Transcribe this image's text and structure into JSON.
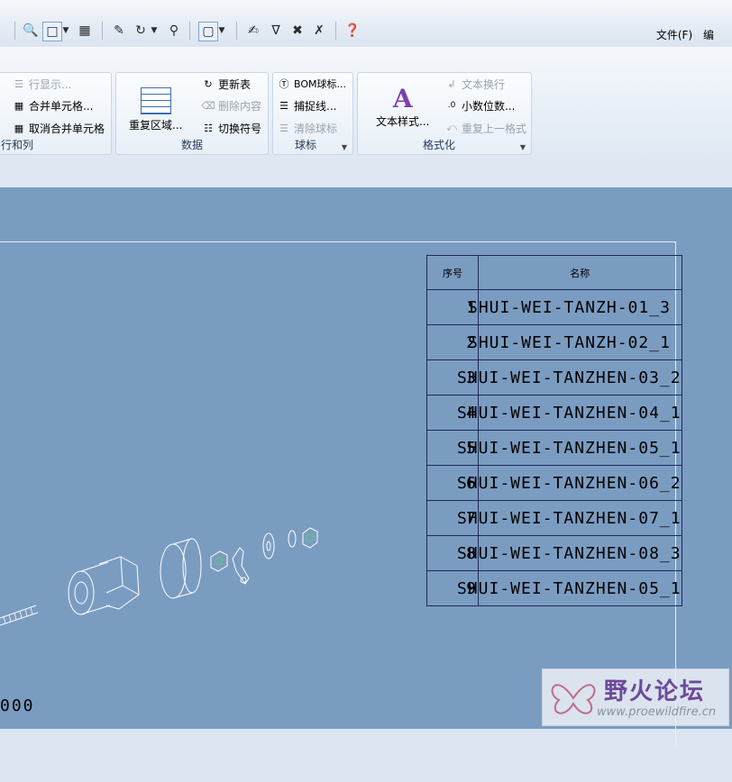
{
  "quick_access": {
    "icons": [
      "binoculars-icon",
      "select-box-icon",
      "dropdown-arrow-icon",
      "table-tool-icon",
      "edit-icon",
      "refresh-icon",
      "zoom-icon",
      "view-box-icon",
      "annotation-icon",
      "annotation-2-icon",
      "annotation-3-icon",
      "annotation-4-icon",
      "help-pointer-icon"
    ],
    "file_menu": "文件(F)",
    "cut_label": "编"
  },
  "ribbon": {
    "rows_cols": {
      "title": "行和列",
      "items": [
        {
          "label": "行显示...",
          "disabled": true
        },
        {
          "label": "合并单元格...",
          "disabled": false
        },
        {
          "label": "取消合并单元格",
          "disabled": false
        }
      ]
    },
    "data": {
      "title": "数据",
      "big_button": "重复区域...",
      "items": [
        {
          "label": "更新表",
          "disabled": false
        },
        {
          "label": "删除内容",
          "disabled": true
        },
        {
          "label": "切换符号",
          "disabled": false
        }
      ]
    },
    "balloons": {
      "title": "球标",
      "items": [
        {
          "label": "BOM球标...",
          "disabled": false
        },
        {
          "label": "捕捉线...",
          "disabled": false
        },
        {
          "label": "清除球标",
          "disabled": true
        }
      ]
    },
    "format": {
      "title": "格式化",
      "big_button": "文本样式...",
      "items": [
        {
          "label": "文本换行",
          "disabled": true
        },
        {
          "label": "小数位数...",
          "disabled": false
        },
        {
          "label": "重复上一格式",
          "disabled": true
        }
      ]
    }
  },
  "bom_table": {
    "headers": [
      "序号",
      "名称"
    ],
    "rows": [
      {
        "num": "1",
        "name": "SHUI-WEI-TANZH-01_3"
      },
      {
        "num": "2",
        "name": "SHUI-WEI-TANZH-02_1"
      },
      {
        "num": "3",
        "name": "SHUI-WEI-TANZHEN-03_2"
      },
      {
        "num": "4",
        "name": "SHUI-WEI-TANZHEN-04_1"
      },
      {
        "num": "5",
        "name": "SHUI-WEI-TANZHEN-05_1"
      },
      {
        "num": "6",
        "name": "SHUI-WEI-TANZHEN-06_2"
      },
      {
        "num": "7",
        "name": "SHUI-WEI-TANZHEN-07_1"
      },
      {
        "num": "8",
        "name": "SHUI-WEI-TANZHEN-08_3"
      },
      {
        "num": "9",
        "name": "SHUI-WEI-TANZHEN-05_1"
      }
    ]
  },
  "drawing": {
    "scale_text": "000"
  },
  "watermark": {
    "title": "野火论坛",
    "url": "www.proewildfire.cn"
  },
  "colors": {
    "canvas": "#7b9cc1",
    "table_line": "#1c2a5c",
    "ribbon_title": "#1e395b"
  }
}
